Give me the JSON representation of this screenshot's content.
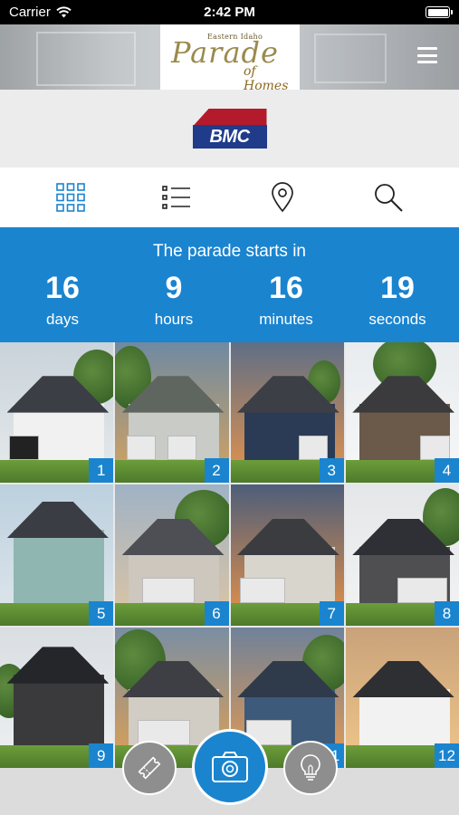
{
  "status_bar": {
    "carrier": "Carrier",
    "time": "2:42 PM"
  },
  "header": {
    "logo_small": "Eastern Idaho",
    "logo_main": "Parade",
    "logo_sub": "of Homes"
  },
  "sponsor": {
    "name": "BMC"
  },
  "toolbar": {
    "items": [
      {
        "icon": "grid-view-icon"
      },
      {
        "icon": "list-view-icon"
      },
      {
        "icon": "map-pin-icon"
      },
      {
        "icon": "search-icon"
      }
    ]
  },
  "countdown": {
    "title": "The parade starts in",
    "units": [
      {
        "value": "16",
        "label": "days"
      },
      {
        "value": "9",
        "label": "hours"
      },
      {
        "value": "16",
        "label": "minutes"
      },
      {
        "value": "19",
        "label": "seconds"
      }
    ]
  },
  "homes": [
    {
      "number": "1"
    },
    {
      "number": "2"
    },
    {
      "number": "3"
    },
    {
      "number": "4"
    },
    {
      "number": "5"
    },
    {
      "number": "6"
    },
    {
      "number": "7"
    },
    {
      "number": "8"
    },
    {
      "number": "9"
    },
    {
      "number": "10"
    },
    {
      "number": "11"
    },
    {
      "number": "12"
    }
  ],
  "bottom_actions": {
    "ticket": "ticket-icon",
    "camera": "camera-icon",
    "bulb": "lightbulb-icon"
  },
  "colors": {
    "accent": "#1a84cf",
    "status_bar": "#000000"
  }
}
